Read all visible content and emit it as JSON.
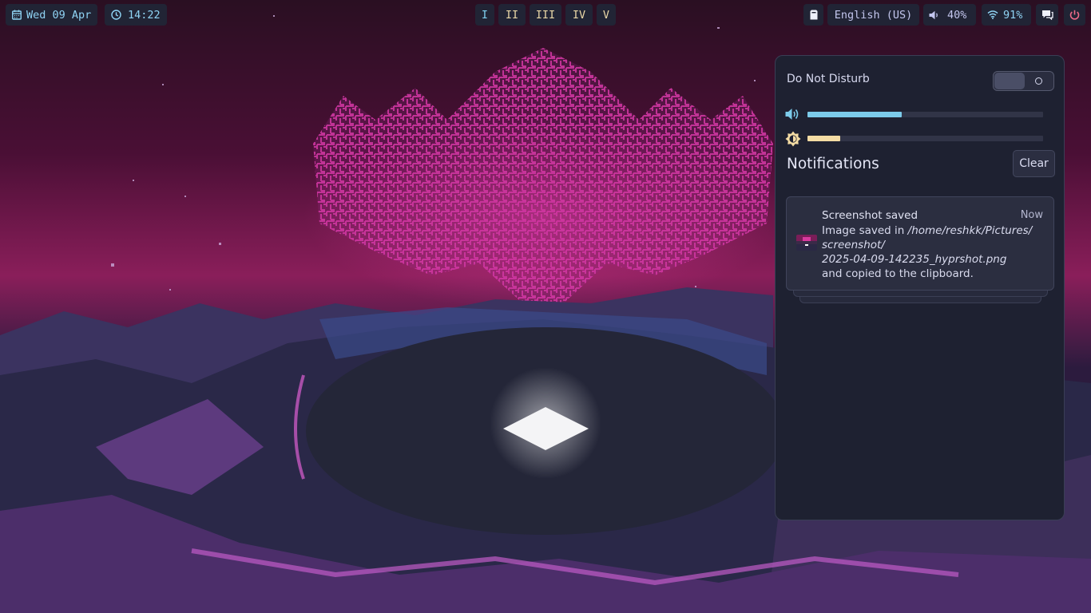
{
  "topbar": {
    "date": "Wed 09 Apr",
    "time": "14:22",
    "workspaces": [
      "I",
      "II",
      "III",
      "IV",
      "V"
    ],
    "active_workspace": "I",
    "keyboard_layout": "English (US)",
    "volume": "40%",
    "wifi": "91%"
  },
  "control_center": {
    "dnd_label": "Do Not Disturb",
    "dnd_enabled": false,
    "volume_level": 0.4,
    "brightness_level": 0.14,
    "notifications_title": "Notifications",
    "clear_label": "Clear",
    "notification": {
      "summary": "Screenshot saved",
      "time": "Now",
      "body_prefix": "Image saved in",
      "path_line1": "/home/reshkk/Pictures/",
      "path_line2": "screenshot/",
      "path_line3": "2025-04-09-142235_hyprshot.png",
      "body_suffix": "and copied to the clipboard."
    }
  },
  "colors": {
    "bar_bg": "#212435",
    "panel_bg": "#1e2131",
    "accent_blue": "#7ccbea",
    "accent_sand": "#f4dca4",
    "power_red": "#ec6a88"
  }
}
